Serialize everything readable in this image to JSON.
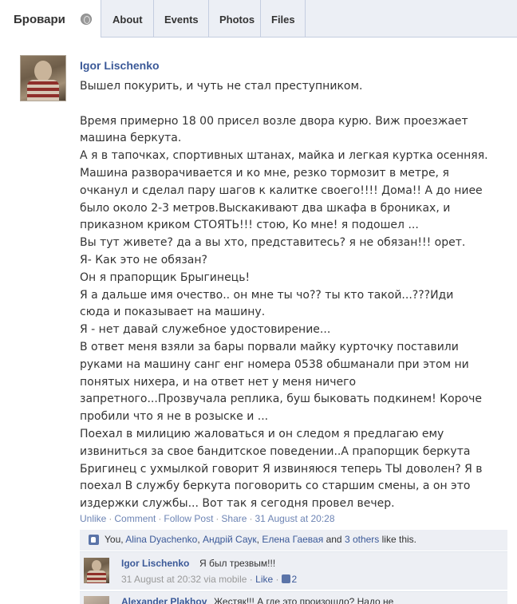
{
  "header": {
    "group_name": "Бровари",
    "tabs": [
      {
        "label": "About"
      },
      {
        "label": "Events"
      },
      {
        "label": "Photos"
      },
      {
        "label": "Files"
      }
    ]
  },
  "post": {
    "author": "Igor Lischenko",
    "lines": [
      "Вышел покурить, и чуть не стал преступником.",
      "",
      "Время примерно 18 00 присел возле двора курю. Виж проезжает",
      "машина беркута.",
      "А я в тапочках, спортивных штанах, майка и легкая куртка осенняя.",
      "Машина разворачивается и ко мне, резко тормозит в метре, я",
      "очканул и сделал пару шагов к калитке своего!!!! Дома!! А до ниее",
      "было около 2-3 метров.Выскакивают два шкафа в брониках, и",
      "приказном криком СТОЯТЬ!!! стою, Ко мне! я подошел ...",
      "Вы тут живете? да а вы хто, представитесь? я не обязан!!! орет.",
      "Я- Как это не обязан?",
      "Он я прапорщик Брыгинець!",
      "Я а дальше имя очество.. он мне ты чо?? ты кто такой...???Иди",
      "сюда и показывает на машину.",
      "Я - нет давай служебное удостовирение...",
      "В ответ меня взяли за бары порвали майку курточку поставили",
      "руками на машину санг енг номера 0538 обшманали при этом ни",
      "понятых нихера, и на ответ нет у меня ничего",
      "запретного...Прозвучала реплика, буш быковать подкинем! Короче",
      "пробили что я не в розыске и ...",
      "Поехал в милицию жаловаться и он следом я предлагаю ему",
      "извиниться за свое бандитское поведении..А прапорщик беркута",
      "Бригинец с ухмылкой говорит Я извиняюся теперь ТЫ доволен? Я в",
      "поехал В службу беркута поговорить со старшим смены, а он это",
      "издержки службы... Вот так я сегодня провел вечер."
    ],
    "actions": {
      "unlike": "Unlike",
      "comment": "Comment",
      "follow_post": "Follow Post",
      "share": "Share",
      "separator": "·",
      "timestamp": "31 August at 20:28"
    }
  },
  "likes": {
    "you": "You,",
    "names": [
      "Alina Dyachenko",
      "Андрій Саук",
      "Елена Гаевая"
    ],
    "comma": ",",
    "and": "and",
    "others": "3 others",
    "suffix": "like this."
  },
  "comments": [
    {
      "author": "Igor Lischenko",
      "text": "Я был трезвым!!!",
      "timestamp": "31 August at 20:32 via mobile",
      "separator": "·",
      "like_label": "Like",
      "like_count": "2"
    },
    {
      "author": "Alexander Plakhov",
      "text": "Жестяк!!! А где это произошло? Надо не"
    }
  ],
  "colors": {
    "link_blue": "#3b5998",
    "action_blue": "#6d84b4",
    "comment_bg": "#edeff4",
    "tabbar_bg": "#eceff5"
  }
}
